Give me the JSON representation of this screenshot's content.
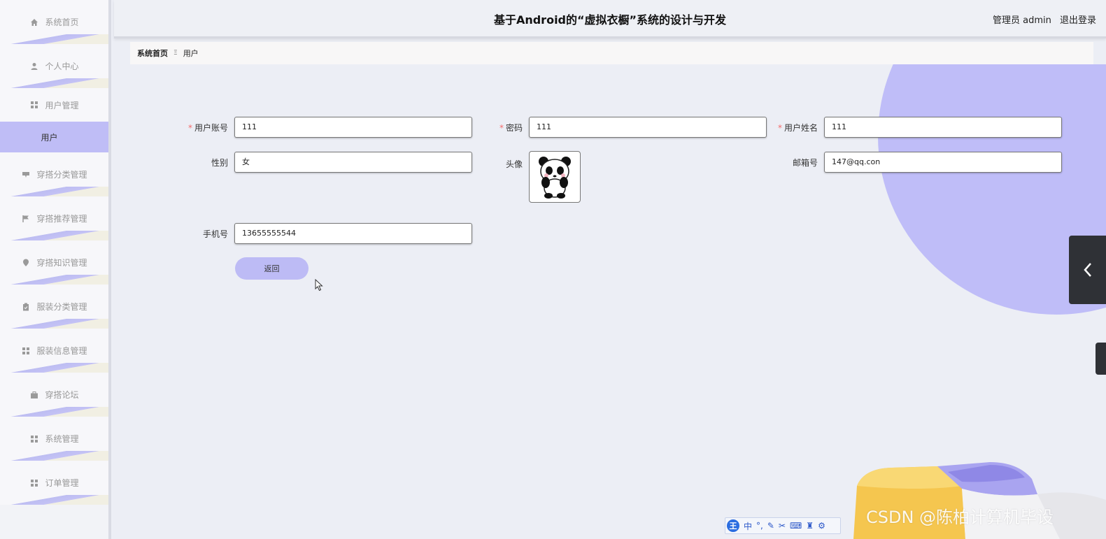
{
  "app": {
    "title": "基于Android的“虚拟衣橱”系统的设计与开发",
    "user_label": "管理员 admin",
    "logout": "退出登录"
  },
  "sidebar": {
    "items": [
      {
        "label": "系统首页",
        "icon": "home-icon"
      },
      {
        "label": "个人中心",
        "icon": "person-icon"
      },
      {
        "label": "用户管理",
        "icon": "grid-icon"
      },
      {
        "label": "用户",
        "icon": "",
        "active": true
      },
      {
        "label": "穿搭分类管理",
        "icon": "tag-icon"
      },
      {
        "label": "穿搭推荐管理",
        "icon": "flag-icon"
      },
      {
        "label": "穿搭知识管理",
        "icon": "pin-icon"
      },
      {
        "label": "服装分类管理",
        "icon": "clipboard-icon"
      },
      {
        "label": "服装信息管理",
        "icon": "grid-icon"
      },
      {
        "label": "穿搭论坛",
        "icon": "briefcase-icon"
      },
      {
        "label": "系统管理",
        "icon": "grid-icon"
      },
      {
        "label": "订单管理",
        "icon": "grid-icon"
      }
    ]
  },
  "breadcrumb": {
    "home": "系统首页",
    "current": "用户"
  },
  "form": {
    "account": {
      "label": "用户账号",
      "value": "111",
      "required": true
    },
    "password": {
      "label": "密码",
      "value": "111",
      "required": true
    },
    "name": {
      "label": "用户姓名",
      "value": "111",
      "required": true
    },
    "gender": {
      "label": "性别",
      "value": "女"
    },
    "avatar": {
      "label": "头像"
    },
    "email": {
      "label": "邮箱号",
      "value": "147@qq.con"
    },
    "phone": {
      "label": "手机号",
      "value": "13655555544"
    },
    "back_button": "返回"
  },
  "ime": {
    "logo": "王",
    "mode": "中"
  },
  "watermark": "CSDN @陈柏计算机毕设",
  "colors": {
    "accent": "#bfbdf8",
    "required": "#f56c6c"
  }
}
